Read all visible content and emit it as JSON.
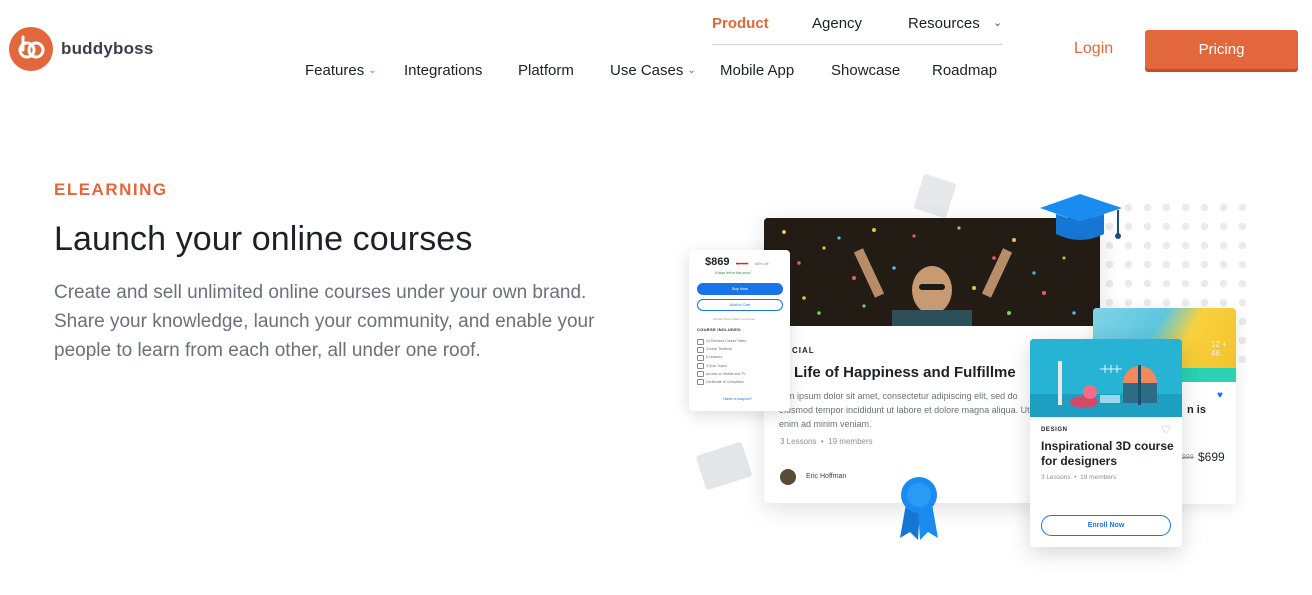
{
  "brand": {
    "name": "buddyboss",
    "accent": "#e2673c",
    "link_blue": "#1a73e8"
  },
  "top_nav": {
    "items": [
      {
        "label": "Product",
        "active": true
      },
      {
        "label": "Agency"
      },
      {
        "label": "Resources",
        "icon": "chevron-down-icon"
      }
    ]
  },
  "main_nav": {
    "items": [
      {
        "label": "Features",
        "active": true,
        "icon": "chevron-down-icon"
      },
      {
        "label": "Integrations"
      },
      {
        "label": "Platform"
      },
      {
        "label": "Use Cases",
        "icon": "chevron-down-icon"
      },
      {
        "label": "Mobile App"
      },
      {
        "label": "Showcase"
      },
      {
        "label": "Roadmap"
      }
    ]
  },
  "header_actions": {
    "login": "Login",
    "pricing": "Pricing"
  },
  "hero": {
    "eyebrow": "ELEARNING",
    "title": "Launch your online courses",
    "description": "Create and sell unlimited online courses under your own brand. Share your knowledge, launch your community, and enable your people to learn from each other, all under one roof."
  },
  "illustration": {
    "buy_card": {
      "price": "$869",
      "old_price": "$1,599",
      "discount": "68% off",
      "days_left": "5 days left at this price!",
      "buy_now": "Buy Now",
      "add_to_cart": "Add to Cart",
      "guarantee": "30-Day Money-Back Guarantee",
      "includes_heading": "COURSE INCLUDES:",
      "includes": [
        "24 Demand Course Video",
        "Course Textbook",
        "8 Lessons",
        "3 Quiz Topics",
        "Access on Mobile and TV",
        "Certificate of Completion"
      ],
      "coupon": "Have a coupon?"
    },
    "main_card": {
      "category": "CIAL",
      "title": "Life of Happiness and Fulfillme",
      "description": "rem ipsum dolor sit amet, consectetur adipiscing elit, sed do eiusmod tempor incididunt ut labore et dolore magna aliqua. Ut enim ad minim veniam.",
      "lessons": "3 Lessons",
      "members": "19 members",
      "author": "Eric Hoffman"
    },
    "back_card": {
      "title_partial": "n is",
      "number": "12 + 46",
      "old_price": "$99",
      "price": "$699"
    },
    "front_card": {
      "category": "DESIGN",
      "title": "Inspirational 3D course for designers",
      "lessons": "3 Lessons",
      "members": "19 members",
      "enroll": "Enroll Now"
    }
  }
}
